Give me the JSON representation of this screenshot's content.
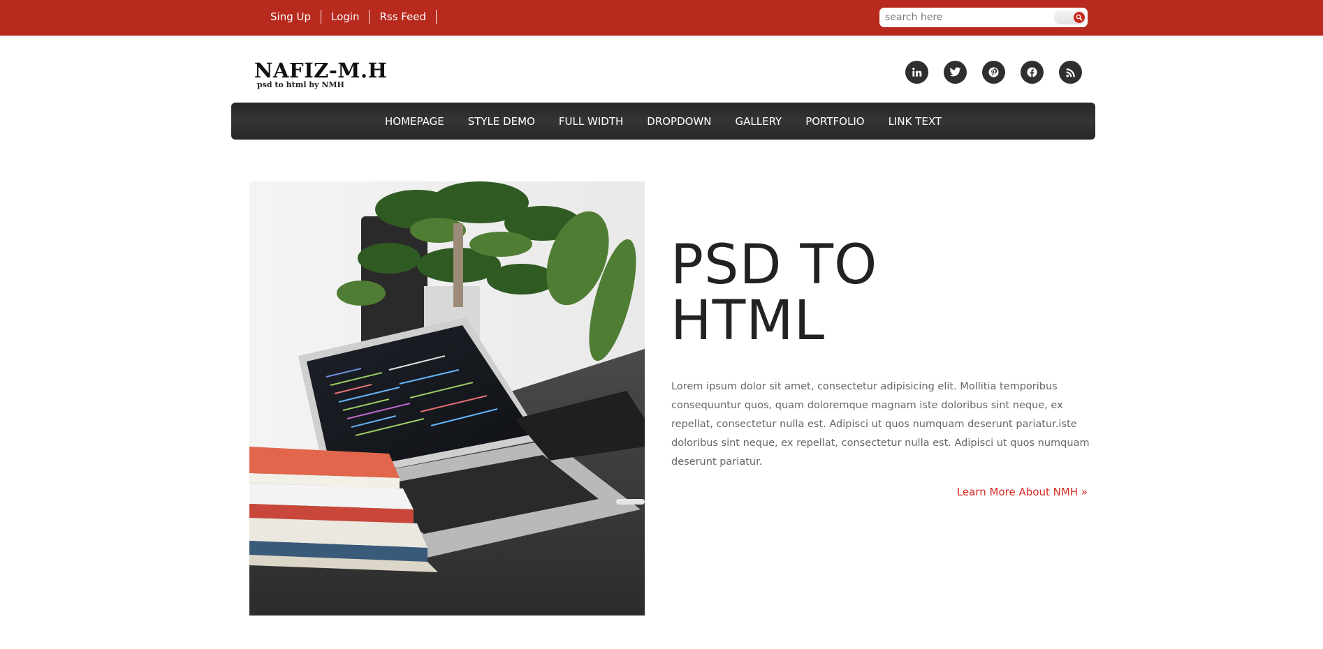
{
  "topbar": {
    "links": [
      "Sing Up",
      "Login",
      "Rss Feed"
    ],
    "search_placeholder": "search here"
  },
  "logo": {
    "title": "NAFIZ-M.H",
    "subtitle": "psd to html by NMH"
  },
  "social": [
    "linkedin-icon",
    "twitter-icon",
    "pinterest-icon",
    "facebook-icon",
    "rss-icon"
  ],
  "nav": {
    "items": [
      "HOMEPAGE",
      "STYLE DEMO",
      "FULL WIDTH",
      "DROPDOWN",
      "GALLERY",
      "PORTFOLIO",
      "LINK TEXT"
    ]
  },
  "hero": {
    "title_line1": "PSD TO",
    "title_line2": "HTML",
    "paragraph": "Lorem ipsum dolor sit amet, consectetur adipisicing elit. Mollitia temporibus consequuntur quos, quam doloremque magnam iste doloribus sint neque, ex repellat, consectetur nulla est. Adipisci ut quos numquam deserunt pariatur.iste doloribus sint neque, ex repellat, consectetur nulla est. Adipisci ut quos numquam deserunt pariatur.",
    "learn_more": "Learn More About NMH »"
  },
  "colors": {
    "topbar": "#b8291e",
    "nav": "#2e2e2e",
    "accent": "#d42a21"
  }
}
